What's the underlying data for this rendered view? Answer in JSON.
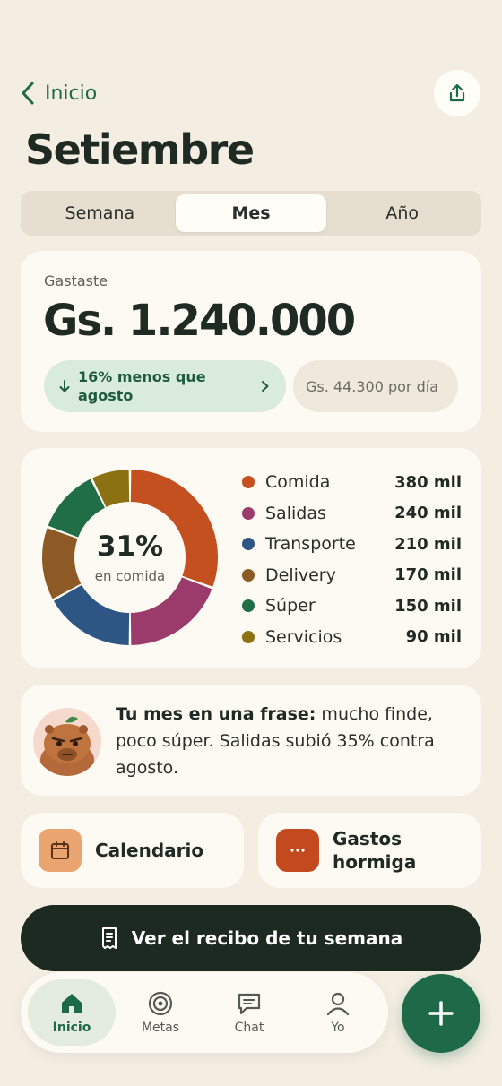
{
  "header": {
    "back_label": "Inicio",
    "share_icon": "share-icon"
  },
  "page_title": "Setiembre",
  "period_tabs": [
    {
      "label": "Semana",
      "active": false
    },
    {
      "label": "Mes",
      "active": true
    },
    {
      "label": "Año",
      "active": false
    }
  ],
  "spent": {
    "label": "Gastaste",
    "amount": "Gs. 1.240.000",
    "comparison": "16% menos que agosto",
    "per_day": "Gs. 44.300 por día"
  },
  "breakdown": {
    "center_value": "31%",
    "center_label": "en comida",
    "categories": [
      {
        "name": "Comida",
        "value_label": "380 mil",
        "value": 380,
        "color": "#c4501f"
      },
      {
        "name": "Salidas",
        "value_label": "240 mil",
        "value": 240,
        "color": "#9b3b6c"
      },
      {
        "name": "Transporte",
        "value_label": "210 mil",
        "value": 210,
        "color": "#2d5684"
      },
      {
        "name": "Delivery",
        "value_label": "170 mil",
        "value": 170,
        "color": "#8d5a26"
      },
      {
        "name": "Súper",
        "value_label": "150 mil",
        "value": 150,
        "color": "#1f6e48"
      },
      {
        "name": "Servicios",
        "value_label": "90 mil",
        "value": 90,
        "color": "#8c7113"
      }
    ]
  },
  "phrase": {
    "bold": "Tu mes en una frase:",
    "text": " mucho finde, poco súper. Salidas subió 35% contra agosto."
  },
  "shortcuts": {
    "calendar_label": "Calendario",
    "ant_expenses_label": "Gastos hormiga"
  },
  "receipt_button": "Ver el recibo de tu semana",
  "tabbar": [
    {
      "label": "Inicio",
      "icon": "home-icon",
      "active": true
    },
    {
      "label": "Metas",
      "icon": "target-icon",
      "active": false
    },
    {
      "label": "Chat",
      "icon": "chat-icon",
      "active": false
    },
    {
      "label": "Yo",
      "icon": "user-icon",
      "active": false
    }
  ],
  "fab_icon": "plus-icon",
  "colors": {
    "accent": "#1e6a48",
    "background": "#f3ede2",
    "card": "#fdfaf3"
  }
}
